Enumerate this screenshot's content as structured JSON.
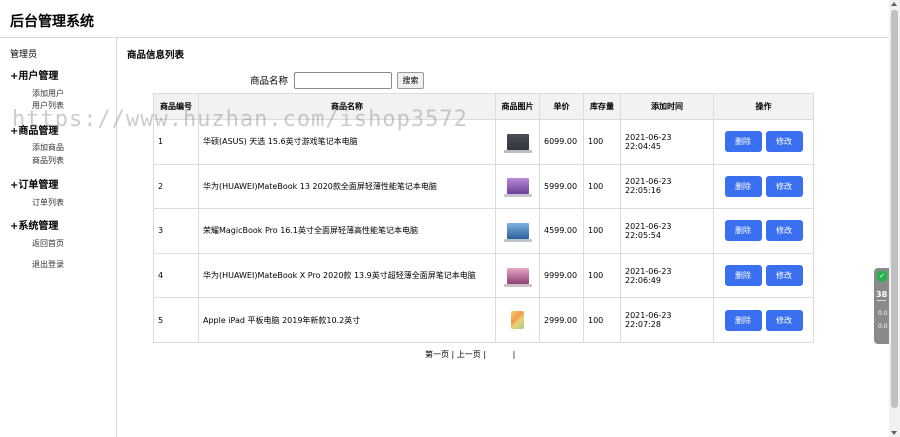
{
  "header": {
    "title": "后台管理系统"
  },
  "sidebar": {
    "admin_label": "管理员",
    "groups": [
      {
        "label": "+用户管理",
        "items": [
          "添加用户",
          "用户列表"
        ]
      },
      {
        "label": "+商品管理",
        "items": [
          "添加商品",
          "商品列表"
        ]
      },
      {
        "label": "+订单管理",
        "items": [
          "订单列表"
        ]
      },
      {
        "label": "+系统管理",
        "items": [
          "返回首页",
          "退出登录"
        ]
      }
    ]
  },
  "main": {
    "title": "商品信息列表",
    "search": {
      "label": "商品名称",
      "value": "",
      "placeholder": "",
      "button": "搜索"
    },
    "table": {
      "headers": [
        "商品编号",
        "商品名称",
        "商品图片",
        "单价",
        "库存量",
        "添加时间",
        "操作"
      ],
      "rows": [
        {
          "id": "1",
          "name": "华硕(ASUS) 天选 15.6英寸游戏笔记本电脑",
          "image": "laptop",
          "price": "6099.00",
          "stock": "100",
          "time": "2021-06-23 22:04:45"
        },
        {
          "id": "2",
          "name": "华为(HUAWEI)MateBook 13 2020款全面屏轻薄性能笔记本电脑",
          "image": "purple",
          "price": "5999.00",
          "stock": "100",
          "time": "2021-06-23 22:05:16"
        },
        {
          "id": "3",
          "name": "荣耀MagicBook Pro 16.1英寸全面屏轻薄高性能笔记本电脑",
          "image": "blue",
          "price": "4599.00",
          "stock": "100",
          "time": "2021-06-23 22:05:54"
        },
        {
          "id": "4",
          "name": "华为(HUAWEI)MateBook X Pro 2020款 13.9英寸超轻薄全面屏笔记本电脑",
          "image": "pink",
          "price": "9999.00",
          "stock": "100",
          "time": "2021-06-23 22:06:49"
        },
        {
          "id": "5",
          "name": "Apple iPad 平板电脑 2019年新款10.2英寸",
          "image": "ipad",
          "price": "2999.00",
          "stock": "100",
          "time": "2021-06-23 22:07:28"
        }
      ],
      "delete_label": "删除",
      "edit_label": "修改"
    },
    "pager": {
      "first": "第一页",
      "sep1": " | ",
      "prev": "上一页",
      "sep2": " | ",
      "sep3": "|"
    }
  },
  "watermark": "https://www.huzhan.com/ishop3572",
  "widget": {
    "number": "38",
    "v1": "0.0",
    "v2": "0.0"
  },
  "colors": {
    "primary_button": "#3a6ff0",
    "header_bg": "#f2f2f2",
    "widget_shield": "#24b24a"
  }
}
